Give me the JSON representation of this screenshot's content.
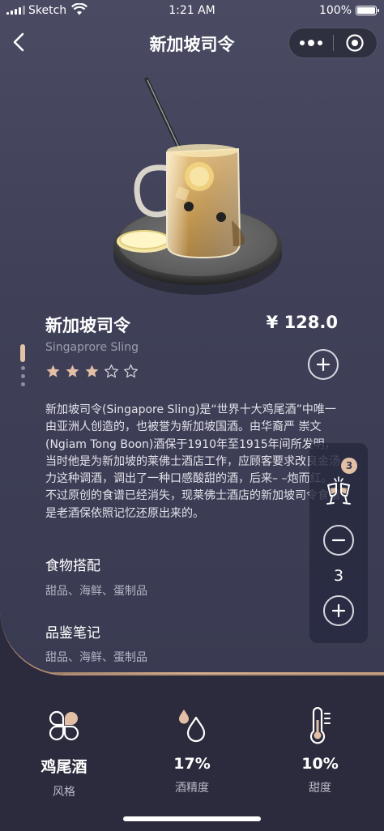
{
  "status_bar": {
    "carrier": "Sketch",
    "time": "1:21 AM",
    "battery": "100%"
  },
  "nav": {
    "title": "新加坡司令"
  },
  "product": {
    "name": "新加坡司令",
    "price": "¥ 128.0",
    "english_name": "Singaprore Sling",
    "rating": 3,
    "rating_max": 5,
    "description": "新加坡司令(Singapore Sling)是“世界十大鸡尾酒”中唯一由亚洲人创造的，也被誉为新加坡国酒。由华裔严 崇文(Ngiam Tong Boon)酒保于1910年至1915年间所发明，当时他是为新加坡的莱佛士酒店工作，应顾客要求改良金汤力这种调酒，调出了一种口感酸甜的酒，后来– –炮而红。不过原创的食谱已经消失，现莱佛士酒店的新加坡司令食谱是老酒保依照记忆还原出来的。"
  },
  "pairing": {
    "heading": "食物搭配",
    "text": "甜品、海鲜、蛋制品"
  },
  "tasting": {
    "heading": "品鉴笔记",
    "text": "甜品、海鲜、蛋制品"
  },
  "cart": {
    "badge": "3",
    "quantity": "3"
  },
  "stats": [
    {
      "value": "鸡尾酒",
      "label": "风格",
      "icon": "style-icon"
    },
    {
      "value": "17%",
      "label": "酒精度",
      "icon": "alcohol-drops-icon"
    },
    {
      "value": "10%",
      "label": "甜度",
      "icon": "thermometer-icon"
    }
  ],
  "colors": {
    "accent": "#e2bfa5",
    "card": "#43445c",
    "background": "#2b2b3d"
  }
}
